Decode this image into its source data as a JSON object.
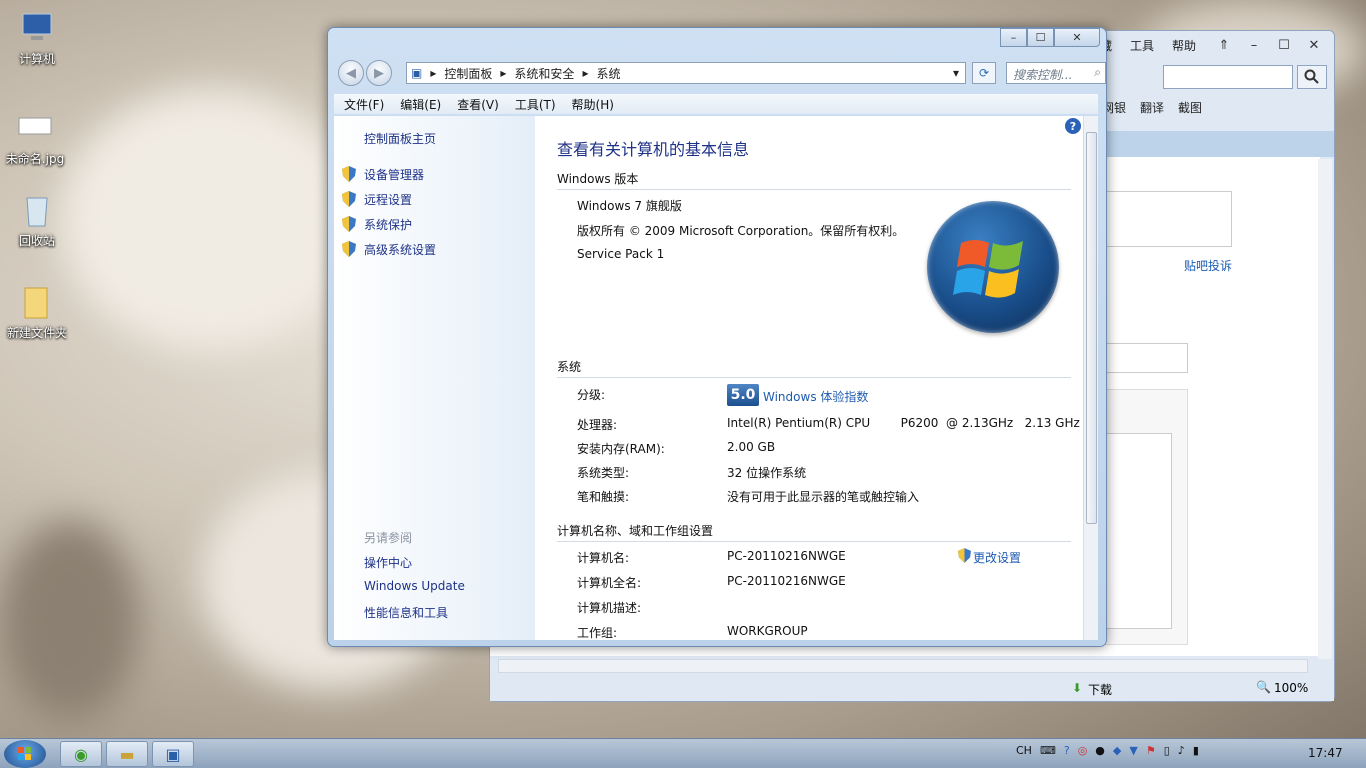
{
  "desktop": {
    "icons": [
      {
        "label": "计算机"
      },
      {
        "label": "未命名.jpg"
      },
      {
        "label": "回收站"
      },
      {
        "label": "新建文件夹"
      }
    ]
  },
  "browser": {
    "menu": [
      "藏",
      "工具",
      "帮助"
    ],
    "toolbar": [
      "网银",
      "翻译",
      "截图"
    ],
    "link": "贴吧投诉",
    "status_download": "下载",
    "zoom": "100%"
  },
  "window": {
    "breadcrumb": [
      "控制面板",
      "系统和安全",
      "系统"
    ],
    "search_placeholder": "搜索控制...",
    "menu": [
      "文件(F)",
      "编辑(E)",
      "查看(V)",
      "工具(T)",
      "帮助(H)"
    ],
    "left": {
      "home": "控制面板主页",
      "links": [
        "设备管理器",
        "远程设置",
        "系统保护",
        "高级系统设置"
      ],
      "see_also_title": "另请参阅",
      "see_also": [
        "操作中心",
        "Windows Update",
        "性能信息和工具"
      ]
    },
    "main": {
      "heading": "查看有关计算机的基本信息",
      "edition_title": "Windows 版本",
      "edition": "Windows 7 旗舰版",
      "copyright": "版权所有 © 2009 Microsoft Corporation。保留所有权利。",
      "service_pack": "Service Pack 1",
      "system_title": "系统",
      "rating_label": "分级:",
      "rating_value": "5.0",
      "rating_link": "Windows 体验指数",
      "cpu_label": "处理器:",
      "cpu_value": "Intel(R) Pentium(R) CPU        P6200  @ 2.13GHz   2.13 GHz",
      "ram_label": "安装内存(RAM):",
      "ram_value": "2.00 GB",
      "type_label": "系统类型:",
      "type_value": "32 位操作系统",
      "pen_label": "笔和触摸:",
      "pen_value": "没有可用于此显示器的笔或触控输入",
      "name_title": "计算机名称、域和工作组设置",
      "name_label": "计算机名:",
      "name_value": "PC-20110216NWGE",
      "fullname_label": "计算机全名:",
      "fullname_value": "PC-20110216NWGE",
      "desc_label": "计算机描述:",
      "workgroup_label": "工作组:",
      "workgroup_value": "WORKGROUP",
      "change_link": "更改设置"
    }
  },
  "taskbar": {
    "lang": "CH",
    "clock": "17:47"
  },
  "colors": {
    "link": "#1e3287",
    "accent": "#1a5bb0"
  }
}
